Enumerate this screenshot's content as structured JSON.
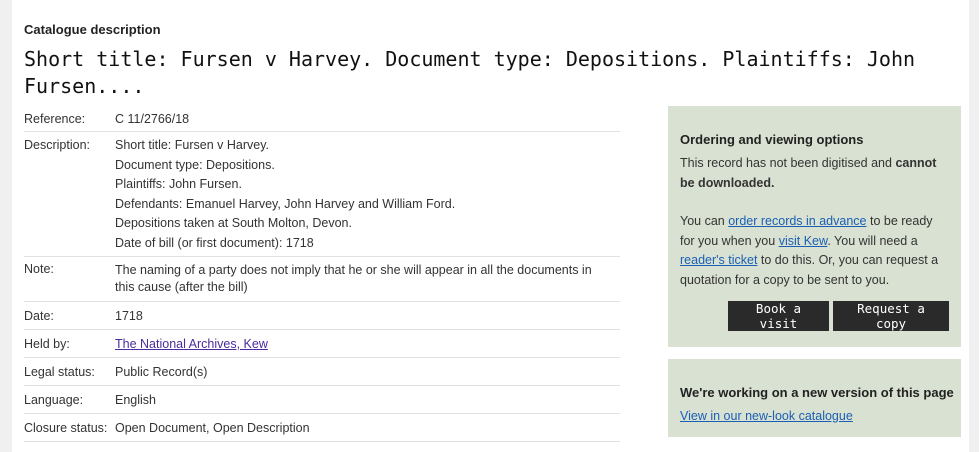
{
  "header": {
    "section_label": "Catalogue description",
    "title": "Short title: Fursen v Harvey. Document type: Depositions. Plaintiffs: John Fursen...."
  },
  "details": {
    "reference_label": "Reference:",
    "reference": "C 11/2766/18",
    "description_label": "Description:",
    "description_lines": [
      "Short title: Fursen v Harvey.",
      "Document type: Depositions.",
      "Plaintiffs: John Fursen.",
      "Defendants: Emanuel Harvey, John Harvey and William Ford.",
      "Depositions taken at South Molton, Devon.",
      "Date of bill (or first document): 1718"
    ],
    "note_label": "Note:",
    "note_lines": [
      "The naming of a party does not imply that he or she will appear in all the documents in",
      "this cause (after the bill)"
    ],
    "date_label": "Date:",
    "date": "1718",
    "held_by_label": "Held by:",
    "held_by": "The National Archives, Kew",
    "legal_status_label": "Legal status:",
    "legal_status": "Public Record(s)",
    "language_label": "Language:",
    "language": "English",
    "closure_status_label": "Closure status:",
    "closure_status": "Open Document, Open Description"
  },
  "ordering_panel": {
    "heading": "Ordering and viewing options",
    "text_1": "This record has not been digitised and",
    "text_1_bold_a": "cannot",
    "text_1_bold_b": "be downloaded.",
    "line1_pre": "You can",
    "link_order": "order records in advance",
    "line1_post": "to be ready",
    "line2_pre": "for you when you",
    "link_visit": "visit Kew",
    "line2_post": ". You will need a",
    "link_ticket": "reader's ticket",
    "line3_post": "to do this. Or, you can request a",
    "line4": "quotation for a copy to be sent to you.",
    "book_button": "Book a visit",
    "copy_button": "Request a copy"
  },
  "new_version_panel": {
    "heading": "We're working on a new version of this page",
    "link": "View in our new-look catalogue"
  }
}
